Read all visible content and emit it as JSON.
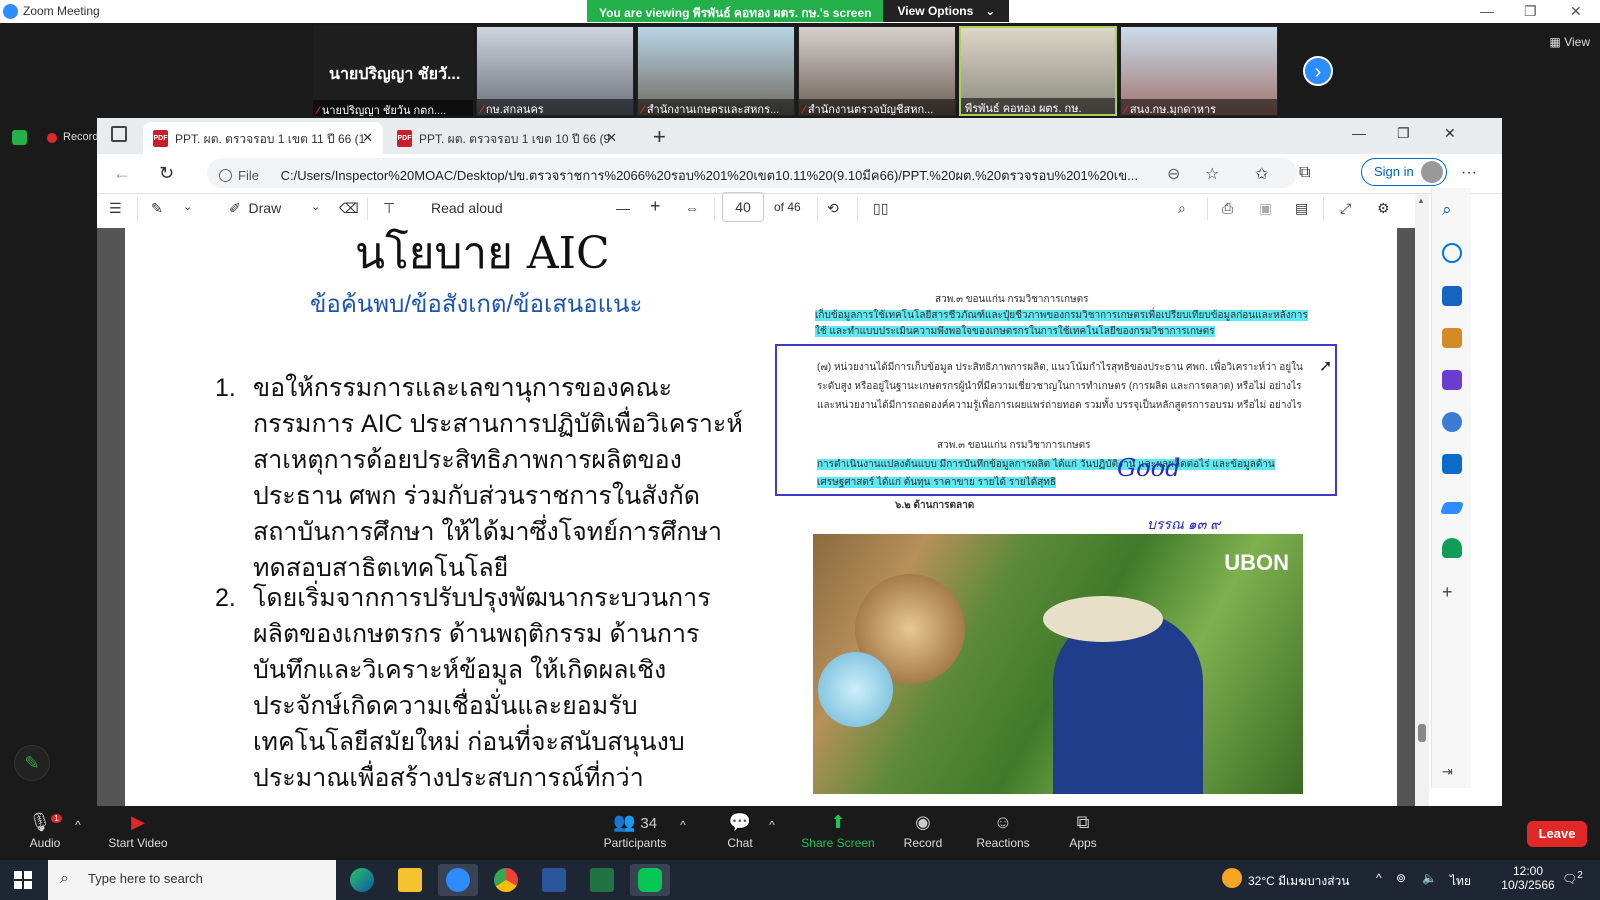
{
  "zoom": {
    "window_title": "Zoom Meeting",
    "banner_text": "You are viewing พีรพันธ์ คอทอง ผตร. กษ.'s screen",
    "view_options_label": "View Options",
    "view_label": "View",
    "recording_label": "Recording...",
    "participants": [
      {
        "name": "นายปริญญา ชัยวัน กตก...."
      },
      {
        "name": "กษ.สกลนคร"
      },
      {
        "name": "สำนักงานเกษตรและสหกร..."
      },
      {
        "name": "สำนักงานตรวจบัญชีสหก..."
      },
      {
        "name": "พีรพันธ์ คอทอง ผตร. กษ."
      },
      {
        "name": "สนง.กษ.มุกดาหาร"
      }
    ],
    "name_only_tile": "นายปริญญา ชัยวั...",
    "controls": {
      "audio": "Audio",
      "start_video": "Start Video",
      "participants": "Participants",
      "participants_count": "34",
      "chat": "Chat",
      "share_screen": "Share Screen",
      "record": "Record",
      "reactions": "Reactions",
      "apps": "Apps",
      "leave": "Leave",
      "audio_badge": "1"
    }
  },
  "browser": {
    "tabs": [
      {
        "title": "PPT. ผต. ตรวจรอบ 1 เขต 11 ปี 66 (1"
      },
      {
        "title": "PPT. ผต. ตรวจรอบ 1 เขต 10 ปี 66 (9"
      }
    ],
    "url_prefix": "File",
    "url": "C:/Users/Inspector%20MOAC/Desktop/ปข.ตรวจราชการ%2066%20รอบ%201%20เขต10.11%20(9.10มีค66)/PPT.%20ผต.%20ตรวจรอบ%201%20เข...",
    "sign_in": "Sign in",
    "pdf_toolbar": {
      "draw": "Draw",
      "read_aloud": "Read aloud",
      "page": "40",
      "of_pages": "of 46"
    }
  },
  "slide": {
    "title": "นโยบาย AIC",
    "subtitle": "ข้อค้นพบ/ข้อสังเกต/ข้อเสนอแนะ",
    "bullets": [
      {
        "num": "1.",
        "text": "ขอให้กรรมการและเลขานุการของคณะกรรมการ AIC ประสานการปฏิบัติเพื่อวิเคราะห์สาเหตุการด้อยประสิทธิภาพการผลิตของ ประธาน ศพก ร่วมกับส่วนราชการในสังกัด สถาบันการศึกษา ให้ได้มาซึ่งโจทย์การศึกษา ทดสอบสาธิตเทคโนโลยี"
      },
      {
        "num": "2.",
        "text": "โดยเริ่มจากการปรับปรุงพัฒนากระบวนการผลิตของเกษตรกร ด้านพฤติกรรม ด้านการบันทึกและวิเคราะห์ข้อมูล ให้เกิดผลเชิงประจักษ์เกิดความเชื่อมั่นและยอมรับเทคโนโลยีสมัยใหม่ ก่อนที่จะสนับสนุนงบประมาณเพื่อสร้างประสบการณ์ที่กว่า"
      }
    ],
    "snippet": {
      "head1": "สวพ.๓ ขอนแก่น กรมวิชาการเกษตร",
      "hl1": "เก็บข้อมูลการใช้เทคโนโลยีสารชีวภัณฑ์และปุ๋ยชีวภาพของกรมวิชาการเกษตรเพื่อเปรียบเทียบข้อมูลก่อนและหลังการใช้ และทำแบบประเมินความพึงพอใจของเกษตรกรในการใช้เทคโนโลยีของกรมวิชาการเกษตร",
      "para": "(๗) หน่วยงานได้มีการเก็บข้อมูล ประสิทธิภาพการผลิต, แนวโน้มกำไรสุทธิของประธาน ศพก. เพื่อวิเคราะห์ว่า อยู่ในระดับสูง หรืออยู่ในฐานะเกษตรกรผู้นำที่มีความเชี่ยวชาญในการทำเกษตร (การผลิต และการตลาด) หรือไม่ อย่างไร และหน่วยงานได้มีการถอดองค์ความรู้เพื่อการเผยแพร่ถ่ายทอด รวมทั้ง บรรจุเป็นหลักสูตรการอบรม หรือไม่ อย่างไร",
      "head2": "สวพ.๓ ขอนแก่น กรมวิชาการเกษตร",
      "hl2": "การดำเนินงานแปลงต้นแบบ มีการบันทึกข้อมูลการผลิต ได้แก่ วันปฏิบัติงาน และผลผลิตต่อไร่ และข้อมูลด้านเศรษฐศาสตร์ ได้แก่ ต้นทุน ราคาขาย รายได้ รายได้สุทธิ",
      "section": "๖.๒ ด้านการตลาด",
      "handwrite1": "Good",
      "handwrite2": "บรรณ ๑๓ ๙"
    },
    "photo_logo": "UBON"
  },
  "taskbar": {
    "search_placeholder": "Type here to search",
    "weather": "32°C มีเมฆบางส่วน",
    "lang": "ไทย",
    "time": "12:00",
    "date": "10/3/2566",
    "notif_count": "2"
  }
}
